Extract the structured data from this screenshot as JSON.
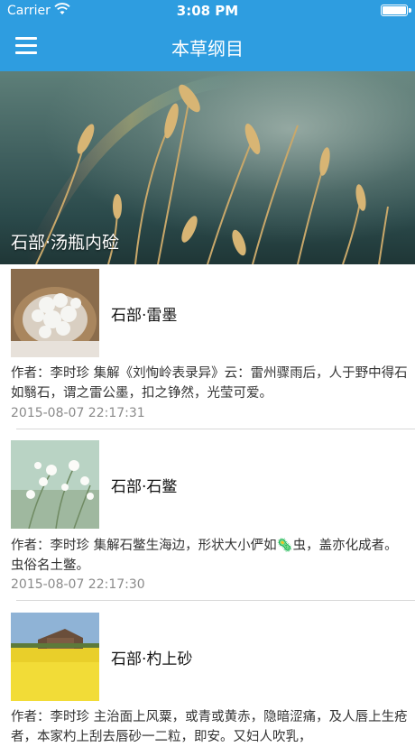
{
  "status_bar": {
    "carrier": "Carrier",
    "time": "3:08 PM",
    "battery_level": 1.0
  },
  "nav": {
    "title": "本草纲目",
    "menu_icon": "hamburger-icon"
  },
  "banner": {
    "caption": "石部·汤瓶内硷"
  },
  "articles": [
    {
      "title": "石部·雷墨",
      "desc": "作者：李时珍 集解《刘恂岭表录异》云：雷州骤雨后，人于野中得石如翳石，谓之雷公墨，扣之铮然，光莹可爱。",
      "time": "2015-08-07 22:17:31"
    },
    {
      "title": "石部·石鳖",
      "desc": "作者：李时珍 集解石鳖生海边，形状大小俨如🦠虫，盖亦化成者。虫俗名土鳖。",
      "time": "2015-08-07 22:17:30"
    },
    {
      "title": "石部·杓上砂",
      "desc": "作者：李时珍 主治面上风粟，或青或黄赤，隐暗涩痛，及人唇上生疮者，本家杓上刮去唇砂一二粒，即安。又妇人吹乳，",
      "time": ""
    }
  ]
}
